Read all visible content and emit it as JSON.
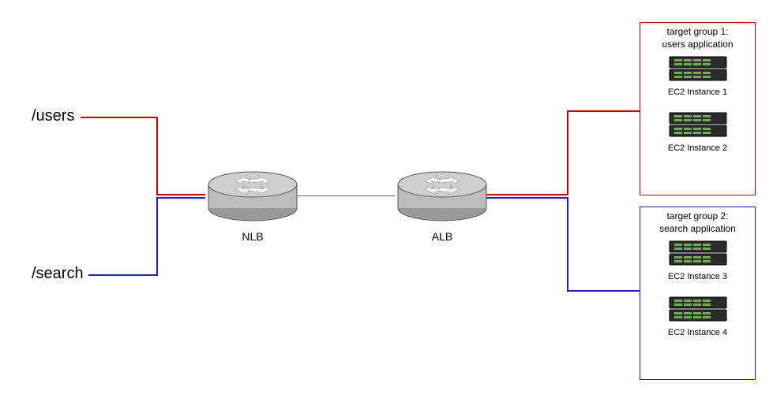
{
  "paths": {
    "users": {
      "label": "/users",
      "color": "#d40000"
    },
    "search": {
      "label": "/search",
      "color": "#1a1ae6"
    }
  },
  "load_balancers": {
    "nlb": {
      "label": "NLB",
      "type": "Network Load Balancer"
    },
    "alb": {
      "label": "ALB",
      "type": "Application Load Balancer"
    }
  },
  "target_groups": [
    {
      "id": "tg1",
      "title_line1": "target group 1:",
      "title_line2": "users application",
      "border_color": "#d40000",
      "instances": [
        {
          "label": "EC2 Instance 1"
        },
        {
          "label": "EC2 Instance 2"
        }
      ]
    },
    {
      "id": "tg2",
      "title_line1": "target group 2:",
      "title_line2": "search application",
      "border_color": "#1a1ae6",
      "instances": [
        {
          "label": "EC2 Instance 3"
        },
        {
          "label": "EC2 Instance 4"
        }
      ]
    }
  ],
  "chart_data": {
    "type": "diagram",
    "description": "Path-based routing via NLB front to ALB, dispatching to two target groups",
    "flow": [
      {
        "source": "/users",
        "via": [
          "NLB",
          "ALB"
        ],
        "target_group": "target group 1: users application",
        "instances": [
          "EC2 Instance 1",
          "EC2 Instance 2"
        ]
      },
      {
        "source": "/search",
        "via": [
          "NLB",
          "ALB"
        ],
        "target_group": "target group 2: search application",
        "instances": [
          "EC2 Instance 3",
          "EC2 Instance 4"
        ]
      }
    ]
  }
}
